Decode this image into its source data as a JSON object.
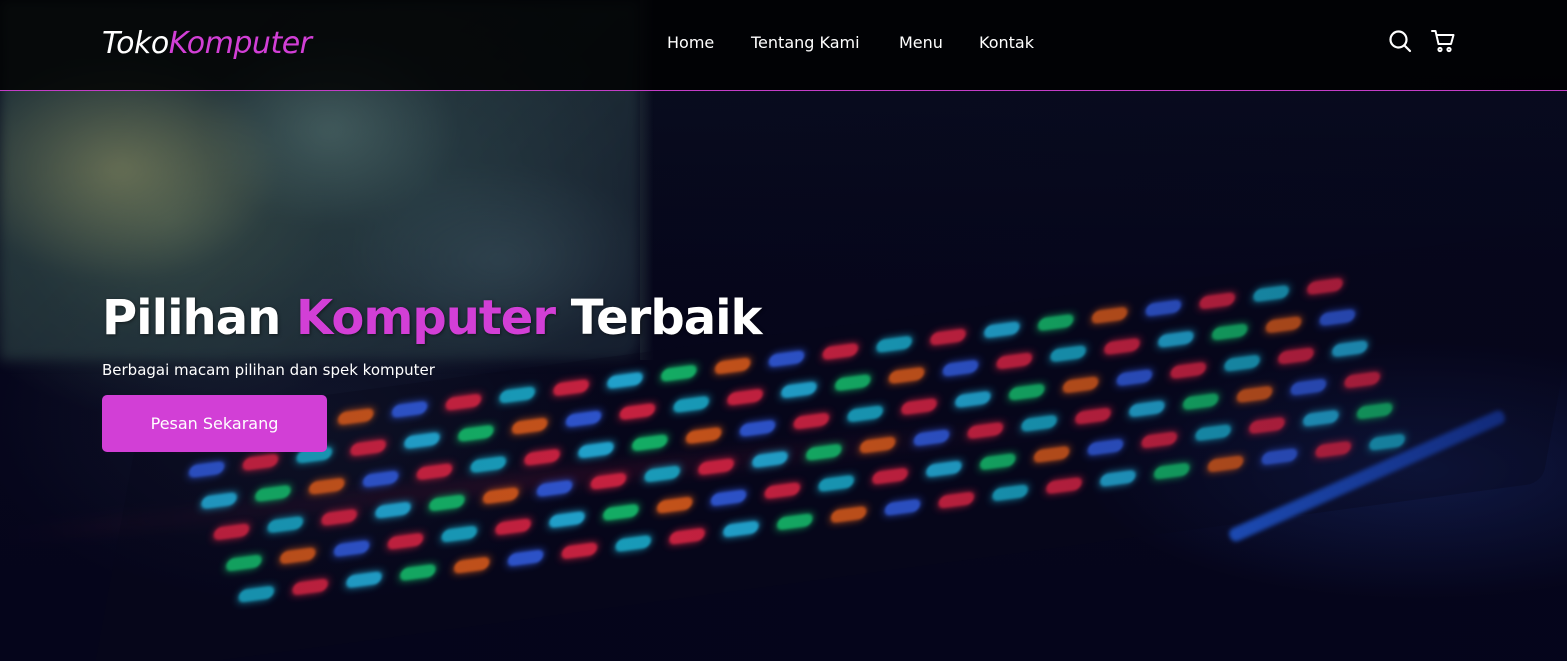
{
  "brand": {
    "logo_part1": "Toko",
    "logo_part2": "Komputer"
  },
  "nav": {
    "items": [
      {
        "label": "Home"
      },
      {
        "label": "Tentang Kami"
      },
      {
        "label": "Menu"
      },
      {
        "label": "Kontak"
      }
    ],
    "icons": [
      "search-icon",
      "cart-icon"
    ]
  },
  "hero": {
    "title_part1": "Pilihan ",
    "title_accent": "Komputer",
    "title_part2": " Terbaik",
    "subtitle": "Berbagai macam pilihan dan spek komputer",
    "cta_label": "Pesan Sekarang"
  },
  "colors": {
    "accent": "#d23fd6",
    "navbar_bg": "#000000",
    "text": "#ffffff"
  }
}
